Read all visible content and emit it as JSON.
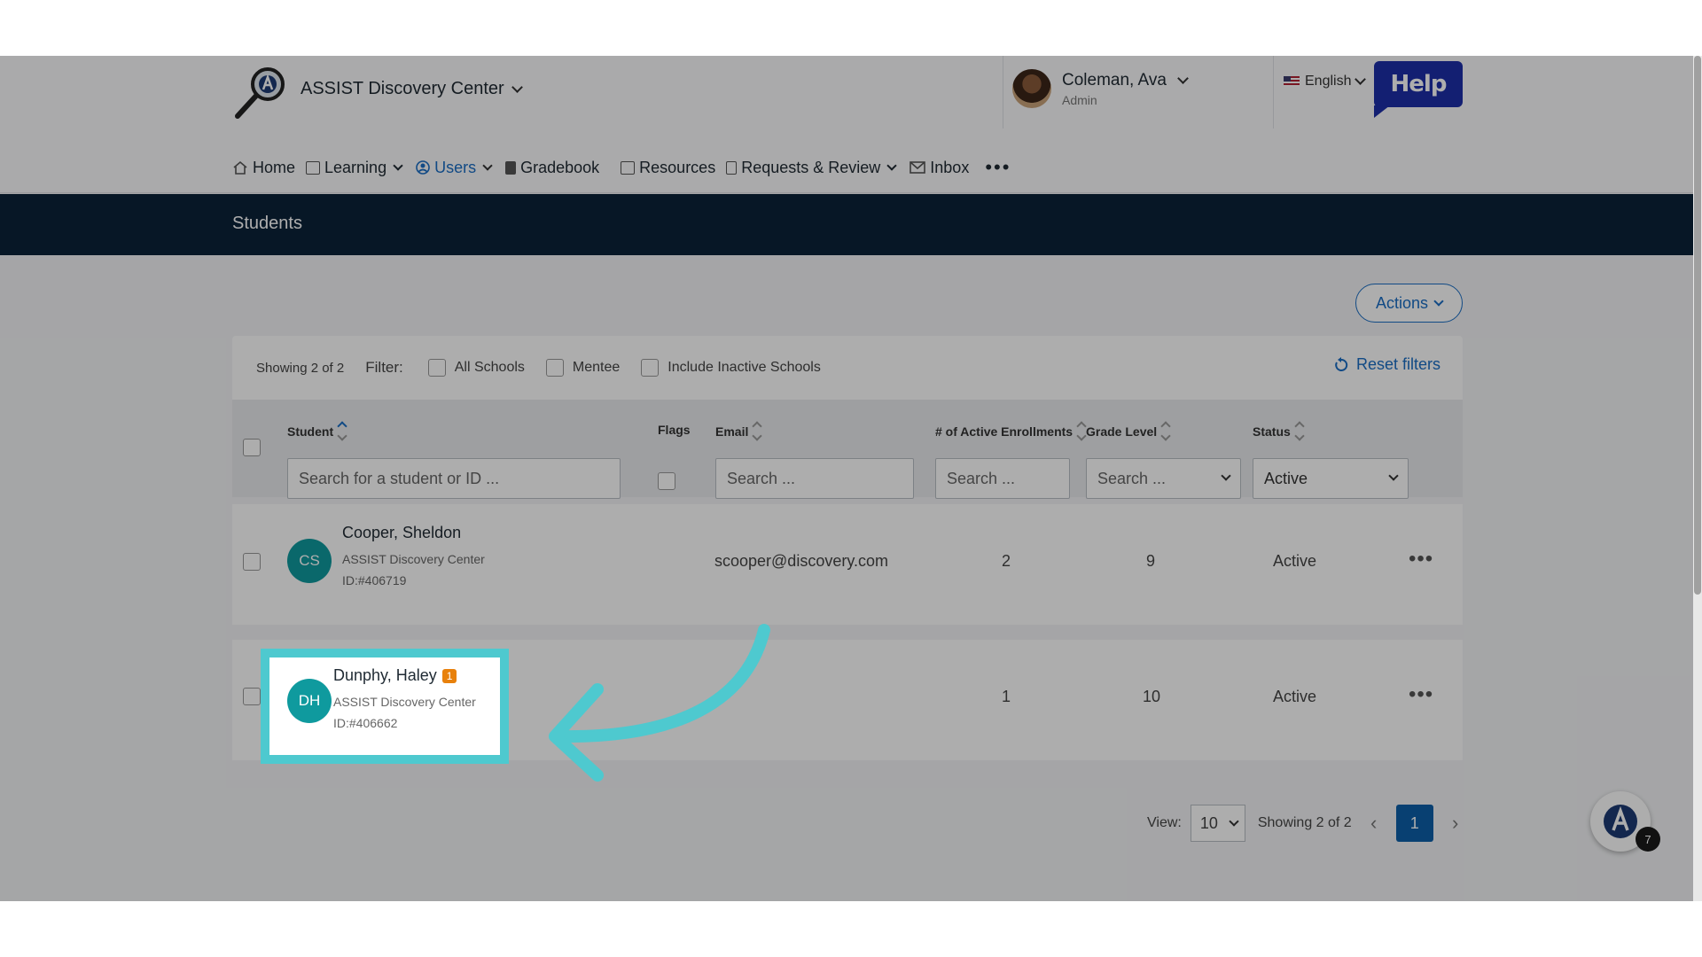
{
  "header": {
    "org_name": "ASSIST Discovery Center",
    "user_name": "Coleman, Ava",
    "user_role": "Admin",
    "language": "English",
    "help_label": "Help"
  },
  "nav": {
    "items": [
      {
        "label": "Home",
        "icon": "home-icon"
      },
      {
        "label": "Learning",
        "icon": "learning-icon"
      },
      {
        "label": "Users",
        "icon": "user-icon",
        "active": true
      },
      {
        "label": "Gradebook",
        "icon": "gradebook-icon"
      },
      {
        "label": "Resources",
        "icon": "resources-icon"
      },
      {
        "label": "Requests & Review",
        "icon": "requests-icon"
      },
      {
        "label": "Inbox",
        "icon": "inbox-icon"
      }
    ],
    "more": "•••"
  },
  "page": {
    "title": "Students",
    "actions_label": "Actions"
  },
  "filters": {
    "showing": "Showing 2 of 2",
    "label": "Filter:",
    "all_schools": "All Schools",
    "mentee": "Mentee",
    "include_inactive": "Include Inactive Schools",
    "reset": "Reset filters"
  },
  "table": {
    "columns": {
      "student": "Student",
      "flags": "Flags",
      "email": "Email",
      "enrollments": "# of Active Enrollments",
      "grade": "Grade Level",
      "status": "Status"
    },
    "placeholders": {
      "student": "Search for a student or ID ...",
      "email": "Search ...",
      "enrollments": "Search ...",
      "grade": "Search ..."
    },
    "status_filter_value": "Active",
    "rows": [
      {
        "initials": "CS",
        "name": "Cooper, Sheldon",
        "school": "ASSIST Discovery Center",
        "id": "ID:#406719",
        "email": "scooper@discovery.com",
        "enrollments": "2",
        "grade": "9",
        "status": "Active"
      },
      {
        "initials": "DH",
        "name": "Dunphy, Haley",
        "flag_count": "1",
        "school": "ASSIST Discovery Center",
        "id": "ID:#406662",
        "email": "",
        "enrollments": "1",
        "grade": "10",
        "status": "Active"
      }
    ]
  },
  "pagination": {
    "view_label": "View:",
    "per_page": "10",
    "showing": "Showing 2 of 2",
    "current_page": "1"
  },
  "fab": {
    "badge": "7"
  },
  "colors": {
    "accent": "#1a6dc4",
    "titlebar": "#0b2239",
    "highlight": "#4ec9cf",
    "avatar": "#0f9a9e",
    "flag_badge": "#e8810c"
  }
}
